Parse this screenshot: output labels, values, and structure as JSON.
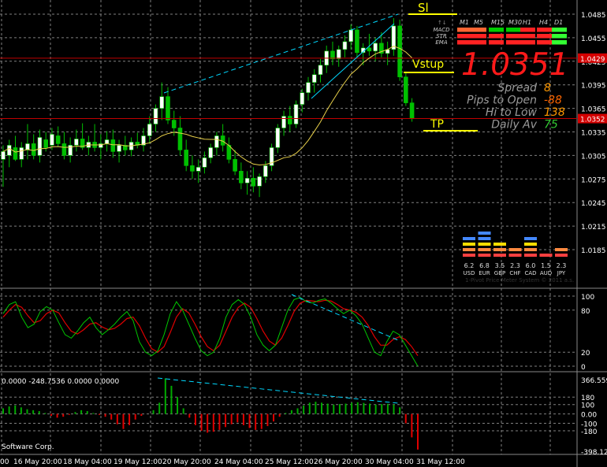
{
  "colors": {
    "background": "#000000",
    "grid": "#7f7f7f",
    "bull": "#ffffff",
    "bear": "#00c000",
    "wick": "#00c000",
    "ma": "#e8d04a",
    "trend": "#00d8ff",
    "hline": "#c00000",
    "yellow": "#ffff00",
    "big_price": "#ff1a1a",
    "stoch_main": "#00c800",
    "stoch_signal": "#e00000",
    "macd_pos": "#00aa00",
    "macd_neg": "#e00000"
  },
  "main_chart": {
    "price_ticks": [
      "1.0485",
      "1.0455",
      "1.0425",
      "1.0395",
      "1.0365",
      "1.0335",
      "1.0305",
      "1.0275",
      "1.0245",
      "1.0215",
      "1.0185"
    ],
    "hline_upper_label": "1.0429",
    "hline_lower_label": "1.0352",
    "label_sl": "Sl",
    "label_vstup": "Vstup",
    "label_tp": "TP",
    "big_price": "1.0351"
  },
  "signal_panel": {
    "timeframes": [
      "M1",
      "M5",
      "M15",
      "M30",
      "H1",
      "H4",
      "D1"
    ],
    "rows": [
      "MACD",
      "STR",
      "EMA"
    ],
    "corner": "↑↓"
  },
  "info_panel": [
    {
      "label": "Spread",
      "value": "8",
      "color": "#ff9900"
    },
    {
      "label": "Pips to Open",
      "value": "-88",
      "color": "#ff6600"
    },
    {
      "label": "Hi to Low",
      "value": "138",
      "color": "#ff9900"
    },
    {
      "label": "Daily Av",
      "value": "75",
      "color": "#33cc33"
    }
  ],
  "currency_strength": {
    "items": [
      {
        "value": "6.2",
        "ccy": "USD"
      },
      {
        "value": "6.8",
        "ccy": "EUR"
      },
      {
        "value": "3.5",
        "ccy": "GBP"
      },
      {
        "value": "2.3",
        "ccy": "CHF"
      },
      {
        "value": "6.0",
        "ccy": "CAD"
      },
      {
        "value": "1.5",
        "ccy": "AUD"
      },
      {
        "value": "2.3",
        "ccy": "JPY"
      }
    ],
    "watermark": "1-Pivot Price Meter System © 2011 a.s."
  },
  "stoch_panel": {
    "ticks": [
      "100",
      "80",
      "20",
      "0"
    ]
  },
  "macd_panel": {
    "header": "0.0000 -248.7536 0.0000 0.0000",
    "ticks": [
      "366.5596",
      "180",
      "100",
      "0.00",
      "-100",
      "-180",
      "-398.12"
    ]
  },
  "copyright": "Software Corp.",
  "time_axis": [
    "00",
    "16 May 20:00",
    "18 May 04:00",
    "19 May 12:00",
    "20 May 20:00",
    "24 May 04:00",
    "25 May 12:00",
    "26 May 20:00",
    "30 May 04:00",
    "31 May 12:00"
  ]
}
